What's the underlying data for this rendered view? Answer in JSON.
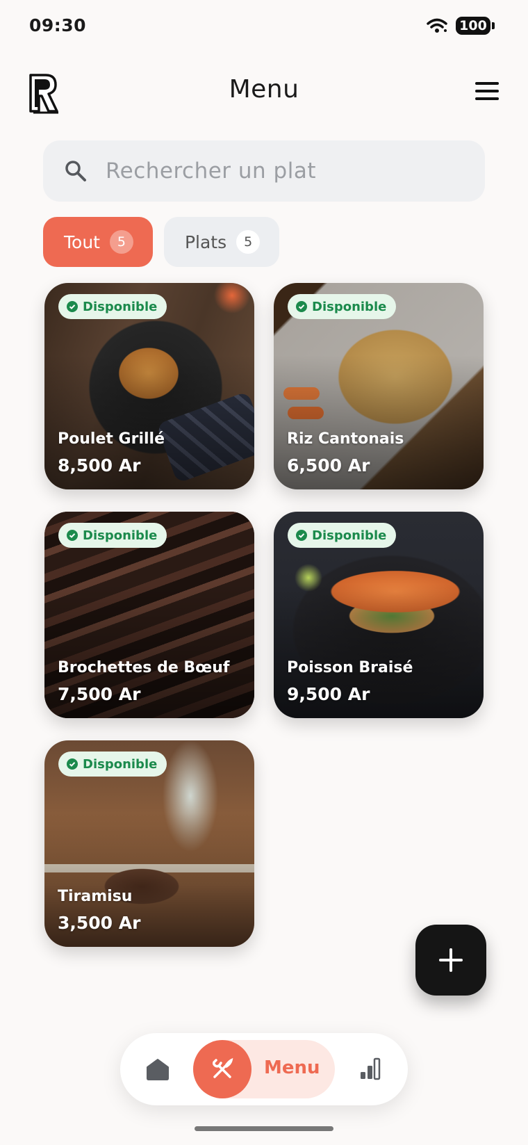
{
  "status_bar": {
    "time": "09:30",
    "battery": "100"
  },
  "header": {
    "title": "Menu",
    "logo_icon": "restaurant-logo-icon",
    "menu_icon": "hamburger-icon"
  },
  "search": {
    "placeholder": "Rechercher un plat",
    "value": ""
  },
  "filters": [
    {
      "label": "Tout",
      "count": "5",
      "active": true
    },
    {
      "label": "Plats",
      "count": "5",
      "active": false
    }
  ],
  "dishes": [
    {
      "status": "Disponible",
      "name": "Poulet Grillé",
      "price": "8,500 Ar"
    },
    {
      "status": "Disponible",
      "name": "Riz Cantonais",
      "price": "6,500 Ar"
    },
    {
      "status": "Disponible",
      "name": "Brochettes de Bœuf",
      "price": "7,500 Ar"
    },
    {
      "status": "Disponible",
      "name": "Poisson Braisé",
      "price": "9,500 Ar"
    },
    {
      "status": "Disponible",
      "name": "Tiramisu",
      "price": "3,500 Ar"
    }
  ],
  "fab": {
    "icon": "plus-icon"
  },
  "bottom_nav": {
    "items": [
      {
        "icon": "home-icon"
      },
      {
        "icon": "utensils-icon",
        "label": "Menu",
        "active": true
      },
      {
        "icon": "bar-chart-icon"
      }
    ]
  },
  "colors": {
    "accent": "#ee6a52",
    "available_green": "#1b8a4c",
    "background": "#fbf9f8"
  }
}
